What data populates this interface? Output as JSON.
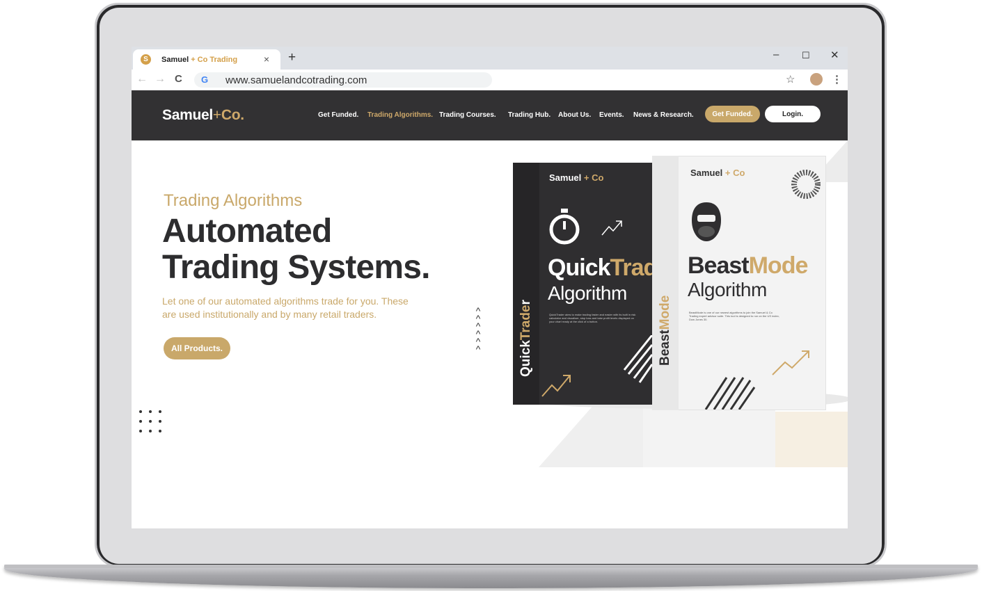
{
  "browser": {
    "tab_title_main": "Samuel",
    "tab_title_accent": " + Co Trading",
    "tab_favicon": "S",
    "tab_close": "×",
    "new_tab": "+",
    "minimize": "–",
    "maximize": "☐",
    "close": "✕",
    "back": "←",
    "forward": "→",
    "reload": "C",
    "google_icon": "G",
    "url": "www.samuelandcotrading.com",
    "star": "☆",
    "menu": "⋮"
  },
  "site": {
    "logo_main": "Samuel",
    "logo_plus": "+",
    "logo_accent": "Co.",
    "nav": [
      "Get Funded.",
      "Trading Algorithms.",
      "Trading Courses.",
      "Trading Hub.",
      "About Us.",
      "Events.",
      "News & Research."
    ],
    "cta_primary": "Get Funded.",
    "cta_login": "Login."
  },
  "hero": {
    "eyebrow": "Trading Algorithms",
    "headline_line1": "Automated",
    "headline_line2": "Trading Systems.",
    "subtext": "Let one of our automated algorithms trade for you. These are used institutionally and by many retail traders.",
    "button": "All Products."
  },
  "products": {
    "quicktrader": {
      "brand_main": "Samuel",
      "brand_accent": "+ Co",
      "name_main": "Quick",
      "name_accent": "Trade",
      "subtitle": "Algorithm",
      "spine": "QuickTrader",
      "description": "QuickTrader aims to make trading faster and easier with its built in risk calculator and visualiser, stop loss and take profit levels displayed on your chart ready at the click of a button."
    },
    "beastmode": {
      "brand_main": "Samuel",
      "brand_accent": "+ Co",
      "name_main": "Beast",
      "name_accent": "Mode",
      "subtitle": "Algorithm",
      "spine": "BeastMode",
      "description": "BeastMode is one of our newest algorithms to join the Samuel & Co Trading expert advisor suite. This tool is designed to run on the US index, Dow Jones 30."
    }
  },
  "colors": {
    "gold": "#c9a86a",
    "dark": "#323133"
  }
}
